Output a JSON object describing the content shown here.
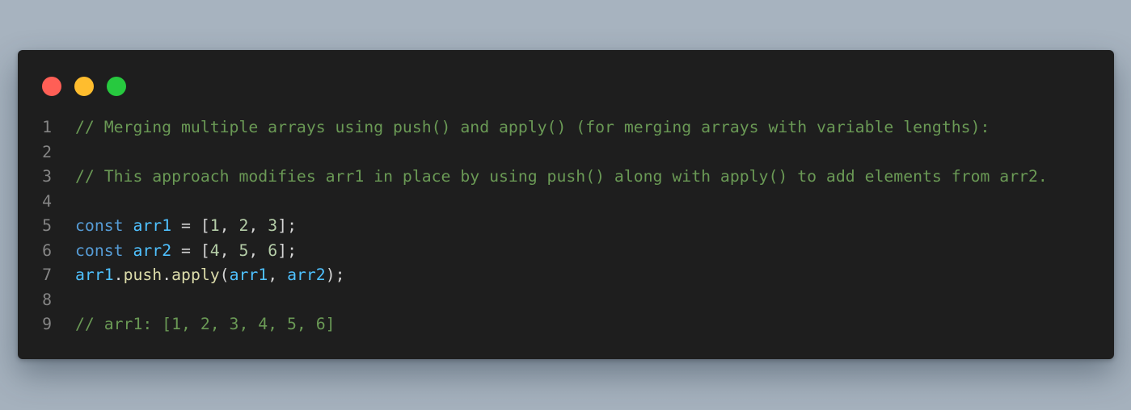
{
  "window": {
    "buttons": {
      "close_color": "#ff5f56",
      "minimize_color": "#ffbd2e",
      "maximize_color": "#27c93f"
    }
  },
  "code": {
    "language": "javascript",
    "lines": [
      {
        "number": "1",
        "tokens": [
          {
            "type": "comment",
            "text": "// Merging multiple arrays using push() and apply() (for merging arrays with variable lengths):"
          }
        ]
      },
      {
        "number": "2",
        "tokens": []
      },
      {
        "number": "3",
        "tokens": [
          {
            "type": "comment",
            "text": "// This approach modifies arr1 in place by using push() along with apply() to add elements from arr2."
          }
        ]
      },
      {
        "number": "4",
        "tokens": []
      },
      {
        "number": "5",
        "tokens": [
          {
            "type": "keyword",
            "text": "const"
          },
          {
            "type": "punc",
            "text": " "
          },
          {
            "type": "var",
            "text": "arr1"
          },
          {
            "type": "punc",
            "text": " = ["
          },
          {
            "type": "num",
            "text": "1"
          },
          {
            "type": "punc",
            "text": ", "
          },
          {
            "type": "num",
            "text": "2"
          },
          {
            "type": "punc",
            "text": ", "
          },
          {
            "type": "num",
            "text": "3"
          },
          {
            "type": "punc",
            "text": "];"
          }
        ]
      },
      {
        "number": "6",
        "tokens": [
          {
            "type": "keyword",
            "text": "const"
          },
          {
            "type": "punc",
            "text": " "
          },
          {
            "type": "var",
            "text": "arr2"
          },
          {
            "type": "punc",
            "text": " = ["
          },
          {
            "type": "num",
            "text": "4"
          },
          {
            "type": "punc",
            "text": ", "
          },
          {
            "type": "num",
            "text": "5"
          },
          {
            "type": "punc",
            "text": ", "
          },
          {
            "type": "num",
            "text": "6"
          },
          {
            "type": "punc",
            "text": "];"
          }
        ]
      },
      {
        "number": "7",
        "tokens": [
          {
            "type": "var",
            "text": "arr1"
          },
          {
            "type": "punc",
            "text": "."
          },
          {
            "type": "fn",
            "text": "push"
          },
          {
            "type": "punc",
            "text": "."
          },
          {
            "type": "fn",
            "text": "apply"
          },
          {
            "type": "punc",
            "text": "("
          },
          {
            "type": "var",
            "text": "arr1"
          },
          {
            "type": "punc",
            "text": ", "
          },
          {
            "type": "var",
            "text": "arr2"
          },
          {
            "type": "punc",
            "text": ");"
          }
        ]
      },
      {
        "number": "8",
        "tokens": []
      },
      {
        "number": "9",
        "tokens": [
          {
            "type": "comment",
            "text": "// arr1: [1, 2, 3, 4, 5, 6]"
          }
        ]
      }
    ]
  }
}
